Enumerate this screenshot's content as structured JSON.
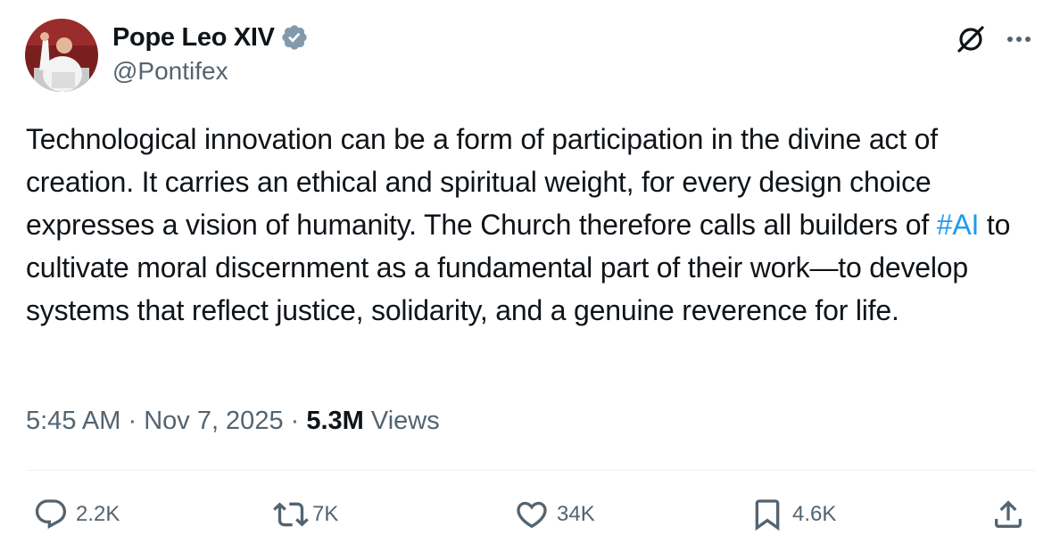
{
  "author": {
    "display_name": "Pope Leo XIV",
    "handle": "@Pontifex",
    "verified": true
  },
  "tweet": {
    "text_before_hashtag": "Technological innovation can be a form of participation in the divine act of creation. It carries an ethical and spiritual weight, for every design choice expresses a vision of humanity. The Church therefore calls all builders of ",
    "hashtag": "#AI",
    "text_after_hashtag": " to cultivate moral discernment as a fundamental part of their work—to develop systems that reflect justice, solidarity, and a genuine reverence for life."
  },
  "meta": {
    "time": "5:45 AM",
    "separator": " · ",
    "date": "Nov 7, 2025",
    "views_count": "5.3M",
    "views_label": "Views"
  },
  "actions": {
    "replies": "2.2K",
    "reposts": "7K",
    "likes": "34K",
    "bookmarks": "4.6K"
  },
  "icons": {
    "grok": "grok-icon",
    "more": "more-icon",
    "verified": "verified-badge-icon",
    "reply": "reply-icon",
    "repost": "repost-icon",
    "like": "like-icon",
    "bookmark": "bookmark-icon",
    "share": "share-icon"
  },
  "colors": {
    "text": "#0f1419",
    "secondary": "#536471",
    "link": "#1d9bf0",
    "verified_badge": "#829aab",
    "divider": "#eff3f4"
  }
}
